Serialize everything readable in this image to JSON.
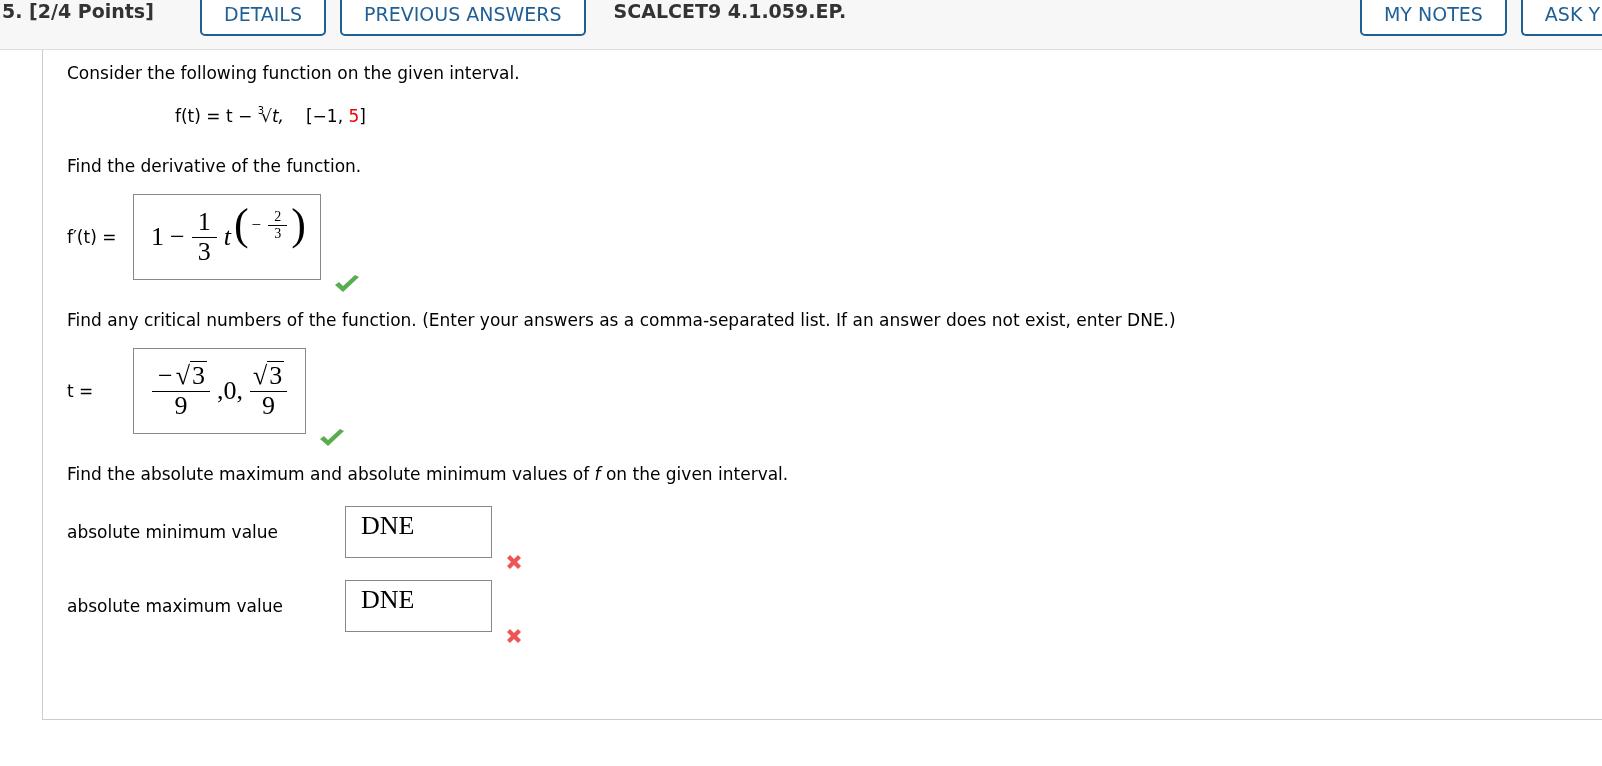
{
  "header": {
    "number": "5.",
    "points": "[2/4 Points]",
    "buttons": [
      {
        "label": "DETAILS"
      },
      {
        "label": "PREVIOUS ANSWERS"
      }
    ],
    "code": "SCALCET9 4.1.059.EP.",
    "right_buttons": [
      {
        "label": "MY NOTES"
      },
      {
        "label": "ASK Y"
      }
    ]
  },
  "question": {
    "intro": "Consider the following function on the given interval.",
    "function": {
      "lhs": "f(t) = t − ",
      "root_index": "3",
      "root_sign": "√",
      "radicand": "t,",
      "interval": [
        {
          "text": "[−1, ",
          "highlight": false
        },
        {
          "text": "5",
          "highlight": true
        },
        {
          "text": "]",
          "highlight": false
        }
      ]
    },
    "parts": [
      {
        "prompt": "Find the derivative of the function.",
        "answers": [
          {
            "label": "f′(t) =",
            "correct": true,
            "value": [
              {
                "kind": "text",
                "text": "1"
              },
              {
                "kind": "text",
                "text": "−"
              },
              {
                "kind": "frac",
                "num": [
                  {
                    "kind": "text",
                    "text": "1"
                  }
                ],
                "den": [
                  {
                    "kind": "text",
                    "text": "3"
                  }
                ]
              },
              {
                "kind": "var",
                "text": "t"
              },
              {
                "kind": "sup",
                "children": [
                  {
                    "kind": "paren",
                    "open": "(",
                    "close": ")",
                    "children": [
                      {
                        "kind": "text",
                        "text": "−"
                      },
                      {
                        "kind": "frac",
                        "num": [
                          {
                            "kind": "text",
                            "text": "2"
                          }
                        ],
                        "den": [
                          {
                            "kind": "text",
                            "text": "3"
                          }
                        ]
                      }
                    ]
                  }
                ]
              }
            ]
          }
        ]
      },
      {
        "prompt": "Find any critical numbers of the function. (Enter your answers as a comma-separated list. If an answer does not exist, enter DNE.)",
        "answers": [
          {
            "label": "t =",
            "correct": true,
            "value": [
              {
                "kind": "frac",
                "num": [
                  {
                    "kind": "text",
                    "text": "−"
                  },
                  {
                    "kind": "sqrt",
                    "sign": "√",
                    "text": "3"
                  }
                ],
                "den": [
                  {
                    "kind": "text",
                    "text": "9"
                  }
                ]
              },
              {
                "kind": "text",
                "text": ",0,"
              },
              {
                "kind": "frac",
                "num": [
                  {
                    "kind": "sqrt",
                    "sign": "√",
                    "text": "3"
                  }
                ],
                "den": [
                  {
                    "kind": "text",
                    "text": "9"
                  }
                ]
              }
            ]
          }
        ]
      },
      {
        "prompt": "Find the absolute maximum and absolute minimum values of *f* on the given interval.",
        "answers": [
          {
            "label": "absolute minimum value",
            "correct": false,
            "value": [
              {
                "kind": "text",
                "text": "DNE"
              }
            ]
          },
          {
            "label": "absolute maximum value",
            "correct": false,
            "value": [
              {
                "kind": "text",
                "text": "DNE"
              }
            ]
          }
        ]
      }
    ]
  }
}
